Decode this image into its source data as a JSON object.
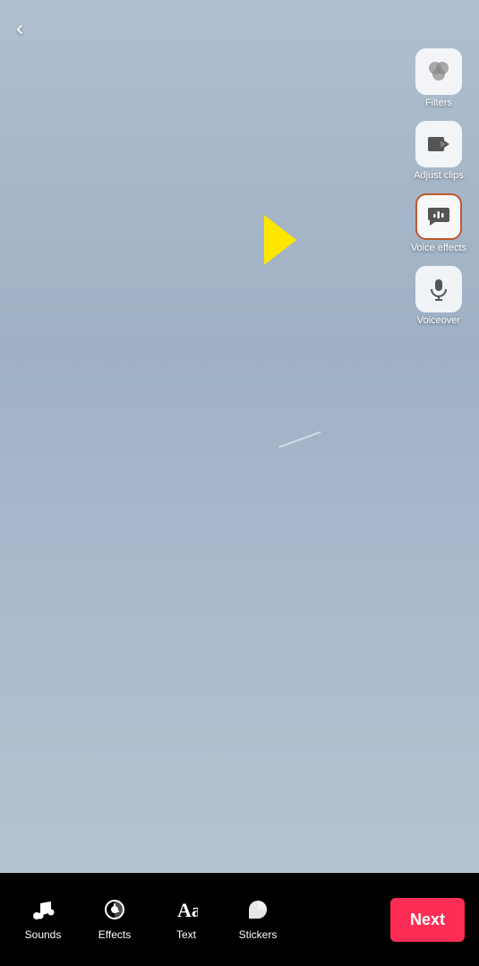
{
  "back_button_label": "‹",
  "toolbar": {
    "items": [
      {
        "id": "filters",
        "label": "Filters",
        "icon": "filters-icon",
        "highlighted": false
      },
      {
        "id": "adjust-clips",
        "label": "Adjust clips",
        "icon": "adjust-clips-icon",
        "highlighted": false
      },
      {
        "id": "voice-effects",
        "label": "Voice effects",
        "icon": "voice-effects-icon",
        "highlighted": true
      },
      {
        "id": "voiceover",
        "label": "Voiceover",
        "icon": "voiceover-icon",
        "highlighted": false
      }
    ]
  },
  "bottom_bar": {
    "items": [
      {
        "id": "sounds",
        "label": "Sounds",
        "icon": "music-note-icon"
      },
      {
        "id": "effects",
        "label": "Effects",
        "icon": "effects-icon"
      },
      {
        "id": "text",
        "label": "Text",
        "icon": "text-icon"
      },
      {
        "id": "stickers",
        "label": "Stickers",
        "icon": "stickers-icon"
      }
    ],
    "next_label": "Next"
  }
}
